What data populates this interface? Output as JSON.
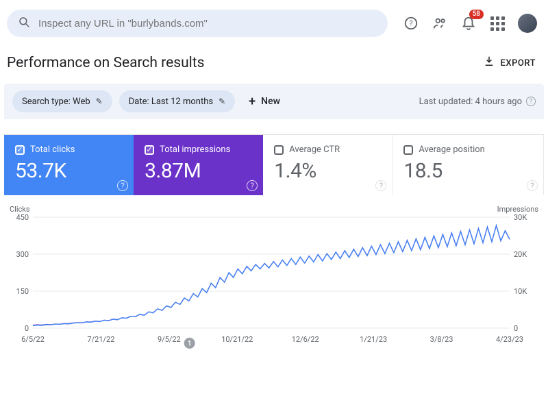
{
  "search": {
    "placeholder": "Inspect any URL in \"burlybands.com\""
  },
  "notifications": {
    "count": "58"
  },
  "page": {
    "title": "Performance on Search results",
    "export": "EXPORT"
  },
  "filters": {
    "search_type": "Search type: Web",
    "date": "Date: Last 12 months",
    "new": "New",
    "updated": "Last updated: 4 hours ago"
  },
  "metrics": {
    "clicks": {
      "label": "Total clicks",
      "value": "53.7K"
    },
    "impressions": {
      "label": "Total impressions",
      "value": "3.87M"
    },
    "ctr": {
      "label": "Average CTR",
      "value": "1.4%"
    },
    "position": {
      "label": "Average position",
      "value": "18.5"
    }
  },
  "chart_data": {
    "type": "line",
    "title": "",
    "xlabel": "",
    "left_axis": {
      "label": "Clicks",
      "ticks": [
        0,
        150,
        300,
        450
      ],
      "ylim": [
        0,
        450
      ]
    },
    "right_axis": {
      "label": "Impressions",
      "ticks": [
        "0",
        "10K",
        "20K",
        "30K"
      ],
      "ylim": [
        0,
        30000
      ]
    },
    "x_ticks": [
      "6/5/22",
      "7/21/22",
      "9/5/22",
      "10/21/22",
      "12/6/22",
      "1/21/23",
      "3/8/23",
      "4/23/23"
    ],
    "note_marker": {
      "after_x_tick": "9/5/22",
      "label": "1"
    },
    "series": [
      {
        "name": "Clicks",
        "axis": "left",
        "color": "#4285f4",
        "values": [
          10,
          12,
          11,
          14,
          13,
          16,
          15,
          18,
          17,
          20,
          22,
          21,
          25,
          24,
          28,
          26,
          32,
          30,
          36,
          34,
          42,
          40,
          48,
          46,
          56,
          52,
          66,
          62,
          78,
          72,
          90,
          84,
          105,
          96,
          122,
          110,
          140,
          126,
          160,
          144,
          182,
          164,
          205,
          186,
          225,
          205,
          240,
          220,
          250,
          232,
          258,
          240,
          262,
          244,
          270,
          248,
          276,
          254,
          282,
          258,
          288,
          264,
          292,
          268,
          298,
          272,
          302,
          278,
          308,
          282,
          314,
          286,
          320,
          290,
          326,
          294,
          332,
          298,
          338,
          302,
          344,
          306,
          350,
          310,
          356,
          314,
          362,
          318,
          368,
          322,
          374,
          326,
          380,
          330,
          386,
          334,
          392,
          338,
          398,
          342,
          404,
          346,
          410,
          350,
          416,
          354,
          395,
          360
        ]
      },
      {
        "name": "Impressions",
        "axis": "right",
        "color": "#6a32c9",
        "values": [
          800,
          900,
          850,
          1000,
          950,
          1100,
          1050,
          1250,
          1200,
          1400,
          1500,
          1450,
          1700,
          1650,
          1900,
          1800,
          2150,
          2050,
          2400,
          2300,
          2800,
          2700,
          3200,
          3100,
          3700,
          3500,
          4400,
          4150,
          5200,
          4800,
          6000,
          5600,
          7000,
          6400,
          8150,
          7350,
          9350,
          8400,
          10700,
          9600,
          12150,
          10950,
          13700,
          12400,
          15000,
          13700,
          16000,
          14700,
          16700,
          15500,
          17200,
          16000,
          17500,
          16300,
          18000,
          16550,
          18400,
          16950,
          18800,
          17200,
          19200,
          17600,
          19500,
          17900,
          19900,
          18150,
          20150,
          18550,
          20550,
          18800,
          20950,
          19100,
          21350,
          19350,
          21750,
          19600,
          22150,
          19900,
          22550,
          20150,
          22950,
          20400,
          23350,
          20700,
          23750,
          20950,
          24150,
          21200,
          24550,
          21500,
          24950,
          21750,
          25350,
          22000,
          25750,
          22300,
          26150,
          22550,
          26550,
          22800,
          26950,
          23100,
          27350,
          23350,
          27750,
          23600,
          26350,
          24000
        ]
      }
    ]
  }
}
